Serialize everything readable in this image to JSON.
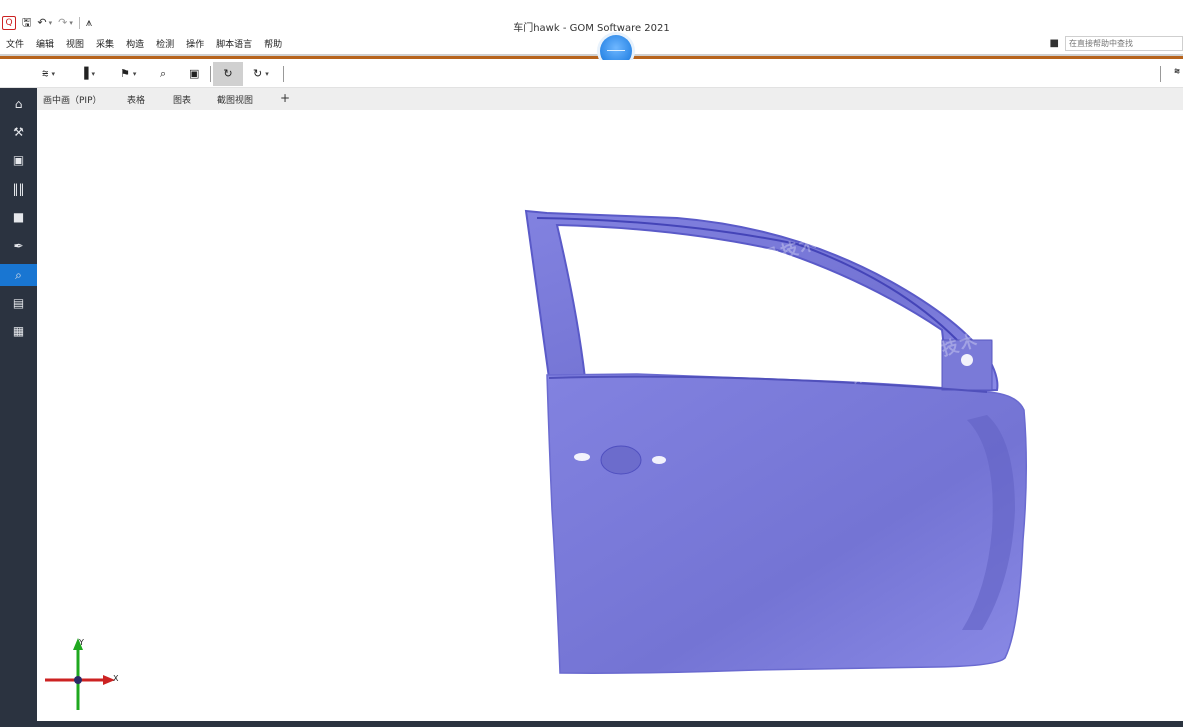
{
  "window": {
    "title": "车门hawk - GOM Software 2021"
  },
  "menubar": {
    "items": [
      "文件",
      "编辑",
      "视图",
      "采集",
      "构造",
      "检测",
      "操作",
      "脚本语言",
      "帮助"
    ]
  },
  "help_search": {
    "placeholder": "在直接帮助中查找"
  },
  "tabs": {
    "items": [
      "画中画（PIP）",
      "表格",
      "图表",
      "截图视图"
    ],
    "add": "+"
  },
  "axis": {
    "y": "Y",
    "x": "X"
  },
  "watermark": {
    "text1": "诺斯顿测量技术（北京）有限公司",
    "text2": "诺斯顿测量技术（北京）有限公司"
  },
  "colors": {
    "accent": "#b7641d",
    "sidebar": "#2b3340",
    "sidebar_active": "#1976d2",
    "mesh": "#7878d8"
  },
  "icons": {
    "qat": [
      "app-logo-icon",
      "save-icon",
      "undo-icon",
      "redo-icon",
      "hierarchy-icon"
    ],
    "toolbar": [
      "curve-tool-icon",
      "chart-tool-icon",
      "flag-icon",
      "search-icon",
      "camera-icon",
      "refresh-icon",
      "rotate-icon",
      "filter-icon"
    ],
    "sidebar": [
      "home-icon",
      "wrench-icon",
      "camera-icon",
      "barcode-icon",
      "video-icon",
      "probe-icon",
      "search-icon",
      "report-icon",
      "grid-icon"
    ]
  }
}
